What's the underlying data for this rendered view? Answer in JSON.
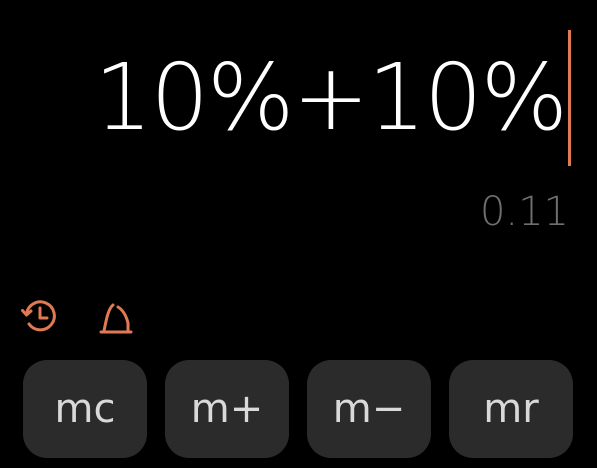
{
  "display": {
    "expression": "10%+10%",
    "result": "0.11"
  },
  "toolbar": {
    "icons": [
      "history-icon",
      "angle-mode-icon"
    ]
  },
  "memory": {
    "buttons": [
      {
        "label": "mc"
      },
      {
        "label": "m+"
      },
      {
        "label": "m−"
      },
      {
        "label": "mr"
      }
    ]
  },
  "colors": {
    "background": "#000000",
    "accent": "#e07a52",
    "result_text": "#6f6f6f",
    "button_bg": "#2b2b2b",
    "button_text": "#d9d9d9"
  }
}
